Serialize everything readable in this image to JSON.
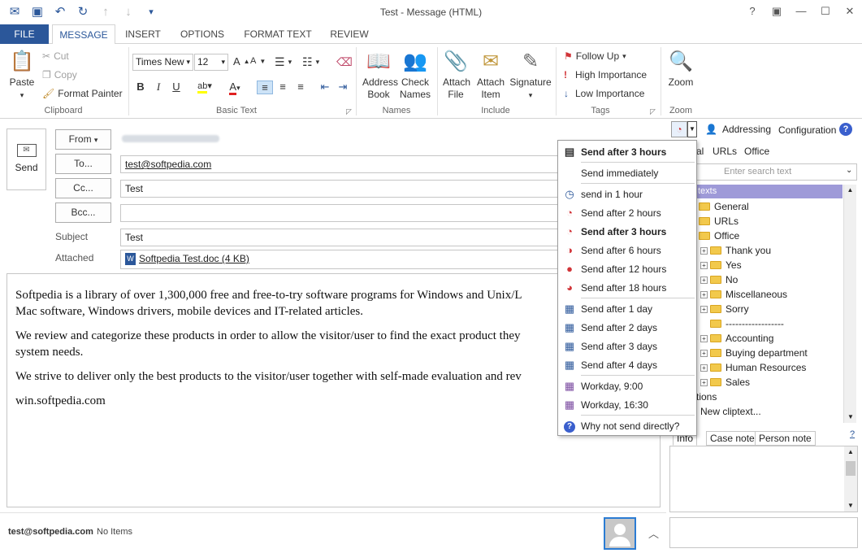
{
  "window": {
    "title": "Test - Message (HTML)"
  },
  "tabs": [
    "FILE",
    "MESSAGE",
    "INSERT",
    "OPTIONS",
    "FORMAT TEXT",
    "REVIEW"
  ],
  "ribbon": {
    "clipboard": {
      "paste": "Paste",
      "cut": "Cut",
      "copy": "Copy",
      "format_painter": "Format Painter",
      "label": "Clipboard"
    },
    "basic_text": {
      "font": "Times New",
      "size": "12",
      "label": "Basic Text"
    },
    "names": {
      "address_book": "Address Book",
      "check_names": "Check Names",
      "label": "Names"
    },
    "include": {
      "attach_file": "Attach File",
      "attach_item": "Attach Item",
      "signature": "Signature",
      "label": "Include"
    },
    "tags": {
      "follow_up": "Follow Up",
      "high": "High Importance",
      "low": "Low Importance",
      "label": "Tags"
    },
    "zoom": {
      "zoom": "Zoom",
      "label": "Zoom"
    }
  },
  "compose": {
    "send": "Send",
    "from_label": "From",
    "to_label": "To...",
    "to_value": "test@softpedia.com",
    "cc_label": "Cc...",
    "cc_value": "Test",
    "bcc_label": "Bcc...",
    "subject_label": "Subject",
    "subject_value": "Test",
    "attached_label": "Attached",
    "attachment": "Softpedia Test.doc (4 KB)",
    "body": [
      "Softpedia is a library of over 1,300,000 free and free-to-try software programs for Windows and Unix/L",
      "Mac software, Windows drivers, mobile devices and IT-related articles.",
      "We review and categorize these products in order to allow the visitor/user to find the exact product they",
      "system needs.",
      "We strive to deliver only the best products to the visitor/user together with self-made evaluation and rev",
      "win.softpedia.com"
    ]
  },
  "status": {
    "email": "test@softpedia.com",
    "items": "No Items"
  },
  "toolbar_right": {
    "addressing": "Addressing",
    "configuration": "Configuration",
    "help": "?"
  },
  "panel": {
    "tabs": [
      "al",
      "URLs",
      "Office"
    ],
    "search_placeholder": "Enter search text",
    "header": "texts",
    "tree": [
      "General",
      "URLs",
      "Office",
      "Thank you",
      "Yes",
      "No",
      "Miscellaneous",
      "Sorry",
      "------------------",
      "Accounting",
      "Buying department",
      "Human Resources",
      "Sales"
    ],
    "actions": [
      "tions",
      "New cliptext..."
    ],
    "bottom_tabs": [
      "Info",
      "Case note",
      "Person note"
    ]
  },
  "menu": {
    "items": [
      {
        "label": "Send after 3 hours",
        "bold": true,
        "icon": "queue-icon"
      },
      {
        "label": "Send immediately",
        "bold": false,
        "icon": ""
      },
      {
        "label": "send in 1 hour",
        "bold": false,
        "icon": "clock-icon"
      },
      {
        "label": "Send after 2 hours",
        "bold": false,
        "icon": "clock-icon"
      },
      {
        "label": "Send after 3 hours",
        "bold": true,
        "icon": "clock-icon"
      },
      {
        "label": "Send after 6 hours",
        "bold": false,
        "icon": "clock-icon"
      },
      {
        "label": "Send after 12 hours",
        "bold": false,
        "icon": "clock-icon"
      },
      {
        "label": "Send after 18 hours",
        "bold": false,
        "icon": "clock-icon"
      },
      {
        "label": "Send after 1 day",
        "bold": false,
        "icon": "calendar-icon"
      },
      {
        "label": "Send after 2 days",
        "bold": false,
        "icon": "calendar-icon"
      },
      {
        "label": "Send after 3 days",
        "bold": false,
        "icon": "calendar-icon"
      },
      {
        "label": "Send after 4 days",
        "bold": false,
        "icon": "calendar-icon"
      },
      {
        "label": "Workday, 9:00",
        "bold": false,
        "icon": "calendar-icon"
      },
      {
        "label": "Workday, 16:30",
        "bold": false,
        "icon": "calendar-icon"
      },
      {
        "label": "Why not send directly?",
        "bold": false,
        "icon": "help-icon"
      }
    ]
  },
  "colors": {
    "accent": "#2b579a",
    "menu_border": "#9b9b9b",
    "panel_header": "#9e9ad8"
  }
}
